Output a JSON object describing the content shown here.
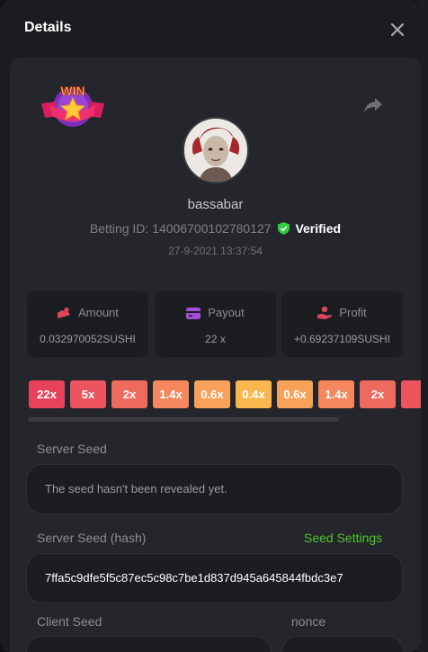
{
  "header": {
    "title": "Details"
  },
  "user": {
    "name": "bassabar",
    "betting_id_text": "Betting ID: 14006700102780127",
    "verified_label": "Verified",
    "date": "27-9-2021 13:37:54"
  },
  "badge": {
    "text": "WIN"
  },
  "stats": [
    {
      "label": "Amount",
      "value": "0.032970052SUSHI",
      "icon": "coins-icon",
      "color": "#e0445a"
    },
    {
      "label": "Payout",
      "value": "22 x",
      "icon": "wallet-icon",
      "color": "#a24dd6"
    },
    {
      "label": "Profit",
      "value": "+0.69237109SUSHI",
      "icon": "hand-coin-icon",
      "color": "#e0445a"
    }
  ],
  "multipliers": [
    {
      "text": "22x",
      "color": "#e8425a"
    },
    {
      "text": "5x",
      "color": "#ec5560"
    },
    {
      "text": "2x",
      "color": "#ef6a5e"
    },
    {
      "text": "1.4x",
      "color": "#f4875d"
    },
    {
      "text": "0.6x",
      "color": "#f8a15a"
    },
    {
      "text": "0.4x",
      "color": "#f8b84f"
    },
    {
      "text": "0.6x",
      "color": "#f8a15a"
    },
    {
      "text": "1.4x",
      "color": "#f4875d"
    },
    {
      "text": "2x",
      "color": "#ef6a5e"
    },
    {
      "text": "",
      "color": "#ec5560"
    }
  ],
  "seeds": {
    "server_seed_label": "Server Seed",
    "server_seed_value": "The seed hasn't been revealed yet.",
    "server_hash_label": "Server Seed (hash)",
    "seed_settings_link": "Seed Settings",
    "server_hash_value": "7ffa5c9dfe5f5c87ec5c98c7be1d837d945a645844fbdc3e7",
    "client_seed_label": "Client Seed",
    "nonce_label": "nonce"
  },
  "colors": {
    "accent_green": "#4ec52b",
    "verified_green": "#2ecc40"
  }
}
